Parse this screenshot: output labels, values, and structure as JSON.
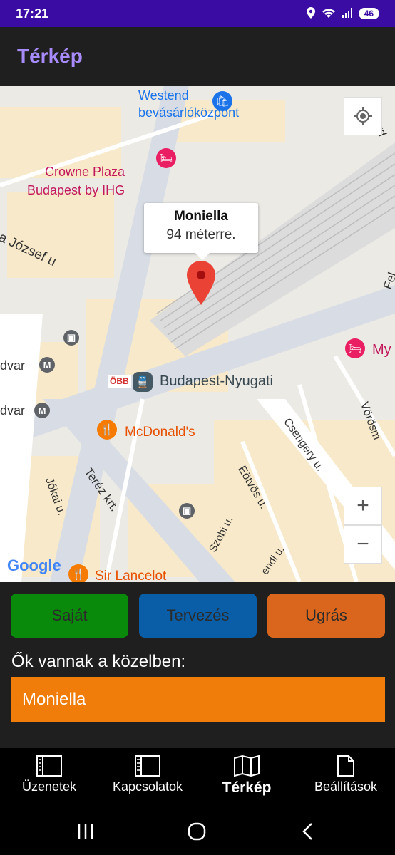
{
  "status": {
    "time": "17:21",
    "battery": "46"
  },
  "app": {
    "title": "Térkép"
  },
  "map": {
    "labels": {
      "westend": "Westend\nbevásárlóközpont",
      "crowne": "Crowne Plaza\nBudapest by IHG",
      "jozsef": "na József u",
      "dvar1": "dvar",
      "dvar2": "dvar",
      "obb": "ÖBB",
      "station": "Budapest-Nyugati",
      "mcdonalds": "McDonald's",
      "terez": "Teréz krt.",
      "jokai": "Jókai u.",
      "csengery": "Csengery u.",
      "eotvos": "Eötvös u.",
      "szobi": "Szobi u.",
      "vorosm": "Vörösm",
      "my": "My",
      "fel": "Fel",
      "ferd": "ferd",
      "endi": "endi u.",
      "lancelot": "Sir Lancelot",
      "google": "Google"
    },
    "info_window": {
      "title": "Moniella",
      "distance": "94 méterre."
    },
    "controls": {
      "zoom_in": "+",
      "zoom_out": "−"
    },
    "colors": {
      "base": "#eceae5",
      "block": "#f7e9c9",
      "road": "#ffffff",
      "roadMajor": "#d8dde5",
      "rail": "#c6c6c6"
    }
  },
  "buttons": {
    "own": {
      "label": "Saját",
      "color": "#0a8a0a"
    },
    "plan": {
      "label": "Tervezés",
      "color": "#0a5ea8"
    },
    "jump": {
      "label": "Ugrás",
      "color": "#d9661c"
    }
  },
  "nearby": {
    "title": "Ők vannak a közelben:",
    "items": [
      {
        "name": "Moniella"
      }
    ]
  },
  "nav": {
    "items": [
      {
        "label": "Üzenetek",
        "icon": "messages-icon"
      },
      {
        "label": "Kapcsolatok",
        "icon": "contacts-icon"
      },
      {
        "label": "Térkép",
        "icon": "map-icon",
        "active": true
      },
      {
        "label": "Beállítások",
        "icon": "settings-document-icon"
      }
    ]
  }
}
